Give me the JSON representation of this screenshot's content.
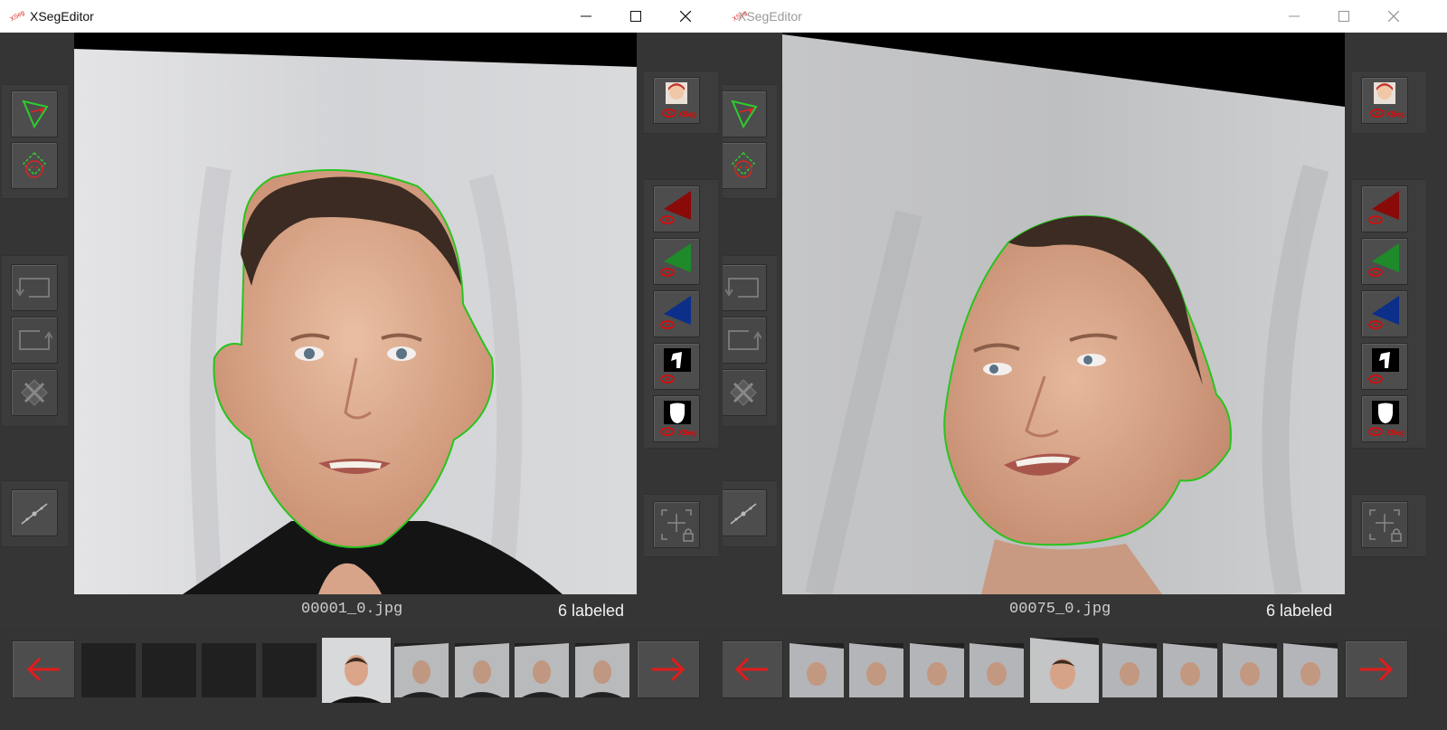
{
  "windows": [
    {
      "title": "XSegEditor",
      "active": true,
      "filename": "00001_0.jpg",
      "labeled_text": "6 labeled",
      "thumbnails": [
        "empty",
        "empty",
        "empty",
        "empty",
        "current",
        "face",
        "face",
        "face",
        "face"
      ]
    },
    {
      "title": "XSegEditor",
      "active": false,
      "filename": "00075_0.jpg",
      "labeled_text": "6 labeled",
      "thumbnails": [
        "face",
        "face",
        "face",
        "face",
        "current",
        "face",
        "face",
        "face",
        "face"
      ]
    }
  ],
  "logo_text": "XSeg",
  "icons": {
    "minimize": "minimize-icon",
    "maximize": "maximize-icon",
    "close": "close-icon",
    "left_toolbar": [
      "poly-include-icon",
      "poly-exclude-icon",
      "undo-icon",
      "redo-icon",
      "delete-poly-icon",
      "view-lock-icon"
    ],
    "right_toolbar": [
      "show-faces-icon",
      "overlay-red-icon",
      "overlay-green-icon",
      "overlay-blue-icon",
      "mask-bw-icon",
      "xseg-mask-icon",
      "view-lock-add-icon"
    ],
    "prev": "arrow-left-icon",
    "next": "arrow-right-icon"
  },
  "colors": {
    "outline": "#28c41e",
    "arrow": "#e31b1b",
    "backdrop": "#cfcfcf"
  }
}
